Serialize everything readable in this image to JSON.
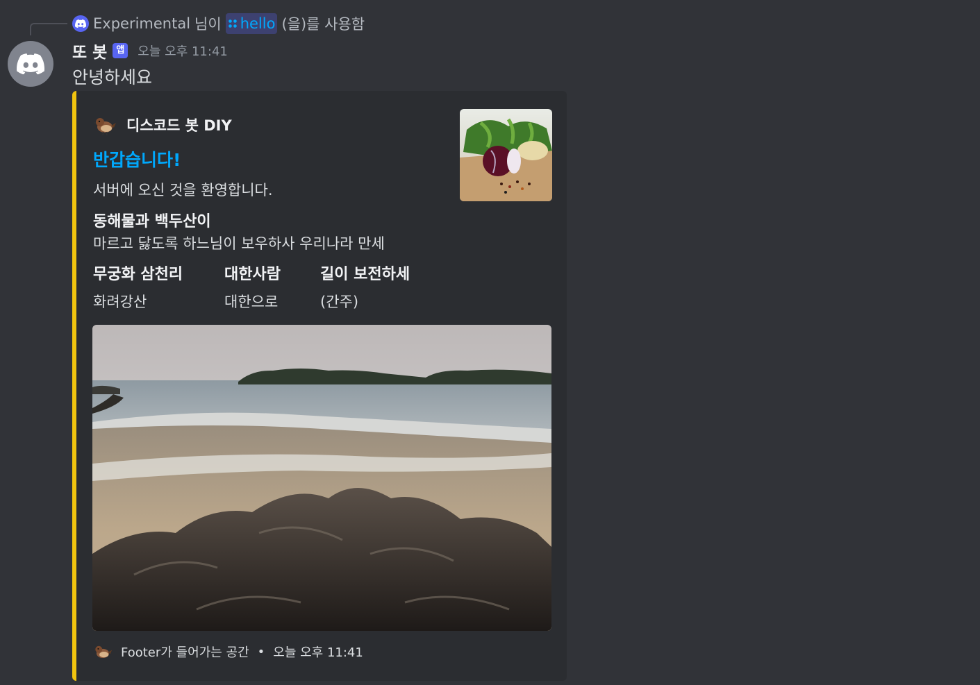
{
  "reply": {
    "user": "Experimental",
    "suffix_user": "님이",
    "command": "hello",
    "suffix": "(을)를 사용함"
  },
  "message": {
    "username": "또 봇",
    "badge": "앱",
    "timestamp": "오늘 오후 11:41",
    "text": "안녕하세요"
  },
  "embed": {
    "accent_color": "#f1c40f",
    "author": {
      "name": "디스코드 봇 DIY",
      "icon": "sparrow-icon"
    },
    "title": "반갑습니다!",
    "description": "서버에 오신 것을 환영합니다.",
    "field_full": {
      "name": "동해물과 백두산이",
      "value": "마르고 닳도록 하느님이 보우하사 우리나라 만세"
    },
    "fields_inline": [
      {
        "name": "무궁화 삼천리",
        "value": "화려강산"
      },
      {
        "name": "대한사람",
        "value": "대한으로"
      },
      {
        "name": "길이 보전하세",
        "value": "(간주)"
      }
    ],
    "footer": {
      "text": "Footer가 들어가는 공간",
      "separator": "•",
      "timestamp": "오늘 오후 11:41",
      "icon": "sparrow-icon"
    }
  },
  "colors": {
    "background": "#313338",
    "embed_bg": "#2b2d31",
    "link": "#00a8fc",
    "brand": "#5865f2"
  }
}
